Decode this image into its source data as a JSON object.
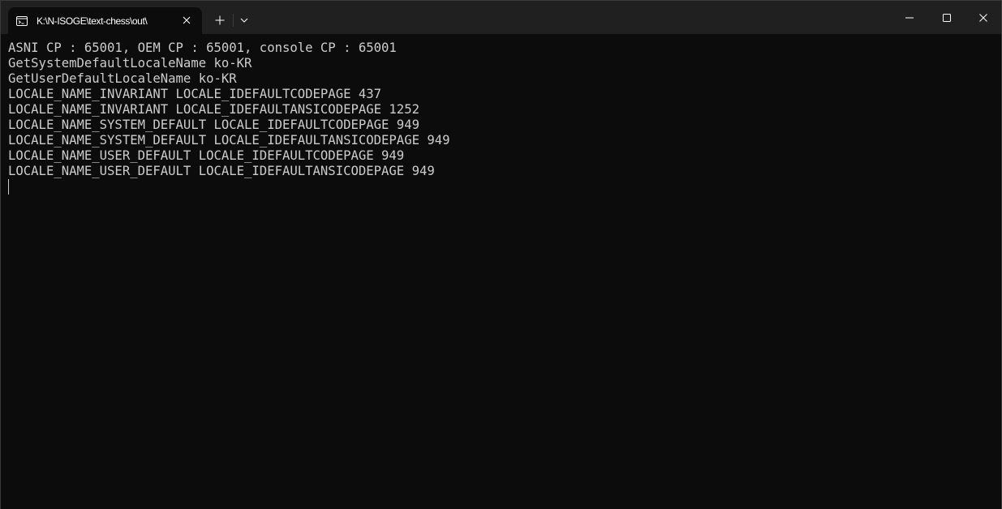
{
  "tab": {
    "title": "K:\\N-ISOGE\\text-chess\\out\\",
    "icon": "console-icon"
  },
  "titlebar": {
    "new_tab_icon": "plus-icon",
    "dropdown_icon": "chevron-down-icon",
    "minimize_icon": "minimize-icon",
    "maximize_icon": "maximize-icon",
    "close_icon": "close-icon"
  },
  "console": {
    "lines": [
      "ASNI CP : 65001, OEM CP : 65001, console CP : 65001",
      "GetSystemDefaultLocaleName ko-KR",
      "GetUserDefaultLocaleName ko-KR",
      "LOCALE_NAME_INVARIANT LOCALE_IDEFAULTCODEPAGE 437",
      "LOCALE_NAME_INVARIANT LOCALE_IDEFAULTANSICODEPAGE 1252",
      "LOCALE_NAME_SYSTEM_DEFAULT LOCALE_IDEFAULTCODEPAGE 949",
      "LOCALE_NAME_SYSTEM_DEFAULT LOCALE_IDEFAULTANSICODEPAGE 949",
      "LOCALE_NAME_USER_DEFAULT LOCALE_IDEFAULTCODEPAGE 949",
      "LOCALE_NAME_USER_DEFAULT LOCALE_IDEFAULTANSICODEPAGE 949"
    ]
  },
  "colors": {
    "titlebar_bg": "#202020",
    "console_bg": "#0c0c0c",
    "console_text": "#cccccc",
    "tab_text": "#ffffff"
  }
}
